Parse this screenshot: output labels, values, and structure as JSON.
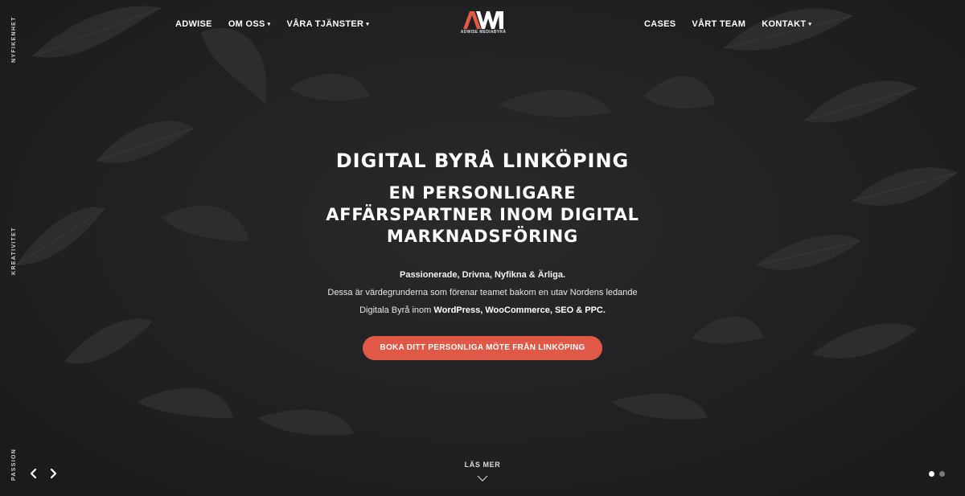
{
  "nav": {
    "left": [
      {
        "label": "ADWISE",
        "has_dropdown": false
      },
      {
        "label": "OM OSS",
        "has_dropdown": true
      },
      {
        "label": "VÅRA TJÄNSTER",
        "has_dropdown": true
      }
    ],
    "right": [
      {
        "label": "CASES",
        "has_dropdown": false
      },
      {
        "label": "VÅRT TEAM",
        "has_dropdown": false
      },
      {
        "label": "KONTAKT",
        "has_dropdown": true
      }
    ],
    "dropdown_caret": "▾"
  },
  "logo": {
    "mark": "AWM",
    "subtitle": "ADWISE MEDIABYRÅ",
    "accent": "#e05846"
  },
  "side_labels": {
    "top": "NYFIKENHET",
    "middle": "KREATIVITET",
    "bottom": "PASSION"
  },
  "hero": {
    "heading": "DIGITAL BYRÅ LINKÖPING",
    "subheading_line1": "EN PERSONLIGARE",
    "subheading_line2": "AFFÄRSPARTNER INOM DIGITAL",
    "subheading_line3": "MARKNADSFÖRING",
    "values": "Passionerade, Drivna, Nyfikna & Ärliga.",
    "desc_line1": "Dessa är värdegrunderna som förenar teamet bakom en utav Nordens ledande",
    "desc_line2_prefix": "Digitala Byrå inom ",
    "desc_line2_bold": "WordPress, WooCommerce, SEO & PPC.",
    "cta_label": "BOKA DITT PERSONLIGA MÖTE FRÅN LINKÖPING"
  },
  "footer": {
    "read_more": "LÄS MER",
    "prev_icon": "chevron-left-icon",
    "next_icon": "chevron-right-icon",
    "down_icon": "chevron-down-icon",
    "slides": 2,
    "active_slide": 1
  },
  "colors": {
    "background": "#222123",
    "accent": "#e05846",
    "text": "#ffffff"
  }
}
